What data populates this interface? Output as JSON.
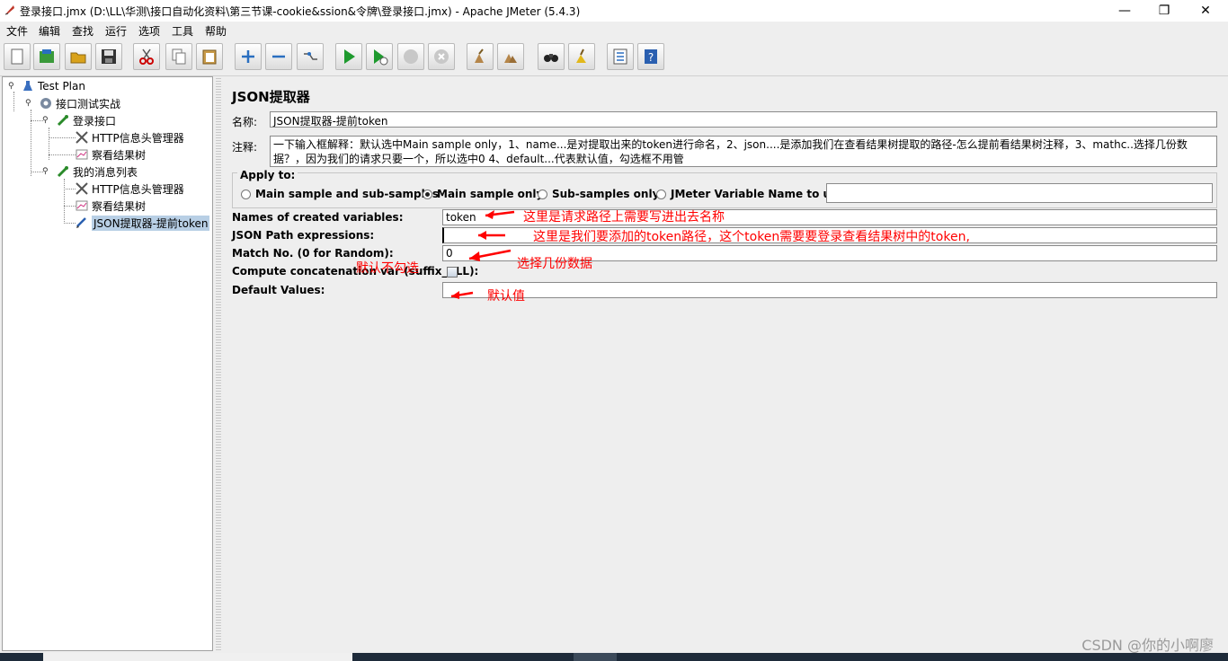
{
  "window": {
    "title": "登录接口.jmx (D:\\LL\\华测\\接口自动化资料\\第三节课-cookie&ssion&令牌\\登录接口.jmx) - Apache JMeter (5.4.3)",
    "minimize": "—",
    "restore": "❐",
    "close": "✕"
  },
  "menu": [
    "文件",
    "编辑",
    "查找",
    "运行",
    "选项",
    "工具",
    "帮助"
  ],
  "toolbar_icons": [
    "new-icon",
    "templates-icon",
    "open-icon",
    "save-icon",
    "cut-icon",
    "copy-icon",
    "paste-icon",
    "expand-icon",
    "collapse-icon",
    "toggle-icon",
    "start-icon",
    "start-no-pause-icon",
    "stop-icon",
    "shutdown-icon",
    "clear-icon",
    "clear-all-icon",
    "search-icon",
    "reset-search-icon",
    "function-helper-icon",
    "help-icon"
  ],
  "tree": {
    "nodes": [
      {
        "label": "Test Plan"
      },
      {
        "label": "接口测试实战"
      },
      {
        "label": "登录接口"
      },
      {
        "label": "HTTP信息头管理器"
      },
      {
        "label": "察看结果树"
      },
      {
        "label": "我的消息列表"
      },
      {
        "label": "HTTP信息头管理器"
      },
      {
        "label": "察看结果树"
      },
      {
        "label": "JSON提取器-提前token"
      }
    ]
  },
  "panel": {
    "heading": "JSON提取器",
    "name_label": "名称:",
    "name_value": "JSON提取器-提前token",
    "comment_label": "注释:",
    "comment_value": "一下输入框解释：默认选中Main sample only，1、name...是对提取出来的token进行命名，2、json....是添加我们在查看结果树提取的路径-怎么提前看结果树注释，3、mathc..选择几份数据？，因为我们的请求只要一个，所以选中0  4、default...代表默认值，勾选框不用管",
    "apply_to": {
      "title": "Apply to:",
      "options": [
        "Main sample and sub-samples",
        "Main sample only",
        "Sub-samples only",
        "JMeter Variable Name to use"
      ],
      "selected": "Main sample only",
      "variable_value": ""
    },
    "fields": {
      "names_label": "Names of created variables:",
      "names_value": "token",
      "json_path_label": "JSON Path expressions:",
      "json_path_value": "",
      "match_label": "Match No. (0 for Random):",
      "match_value": "0",
      "concat_label": "Compute concatenation var (suffix_ALL):",
      "concat_checked": false,
      "default_label": "Default Values:",
      "default_value": ""
    }
  },
  "annotations": {
    "names": "这里是请求路径上需要写进出去名称",
    "json_path": "这里是我们要添加的token路径，这个token需要要登录查看结果树中的token,",
    "match": "选择几份数据",
    "concat": "默认不勾选",
    "default": "默认值",
    "color": "#ff0000"
  },
  "watermark": "CSDN @你的小啊廖"
}
